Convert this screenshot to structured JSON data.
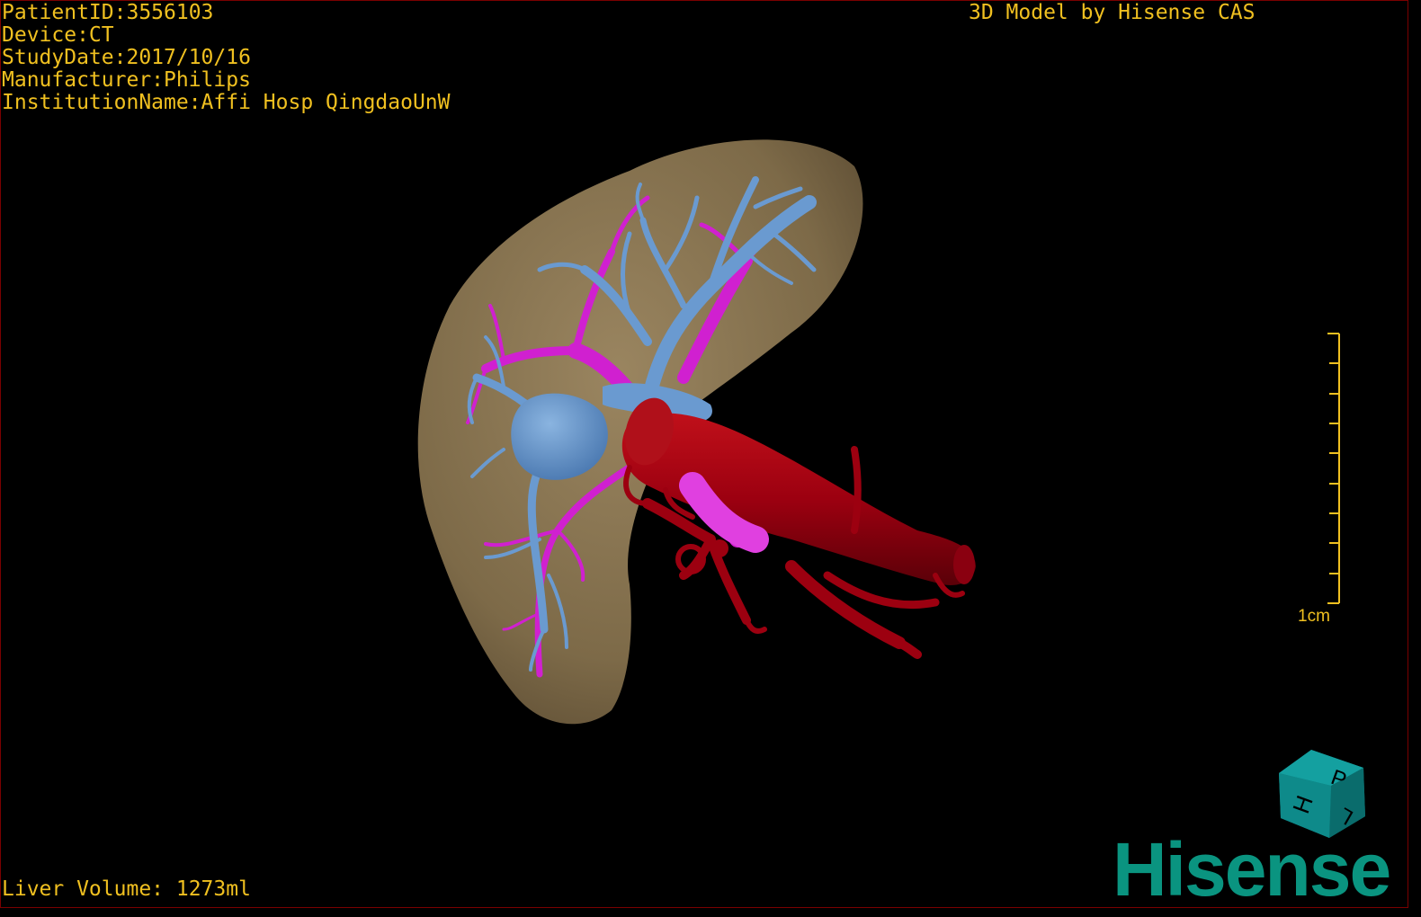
{
  "study": {
    "patient_id": "PatientID:3556103",
    "device": "Device:CT",
    "study_date": "StudyDate:2017/10/16",
    "manufacturer": "Manufacturer:Philips",
    "institution": "InstitutionName:Affi Hosp QingdaoUnW"
  },
  "viewer": {
    "title": "3D Model by Hisense CAS",
    "liver_volume": "Liver Volume: 1273ml",
    "scale_label": "1cm",
    "brand": "Hisense",
    "orientation_cube_letters": [
      "P",
      "H",
      "L"
    ]
  },
  "colors": {
    "overlay_text": "#f0c020",
    "liver": "#8a7550",
    "portal_vein": "#6a9ad0",
    "hepatic_artery": "#d020d0",
    "vena_cava": "#a00010",
    "brand": "#0a9480"
  }
}
